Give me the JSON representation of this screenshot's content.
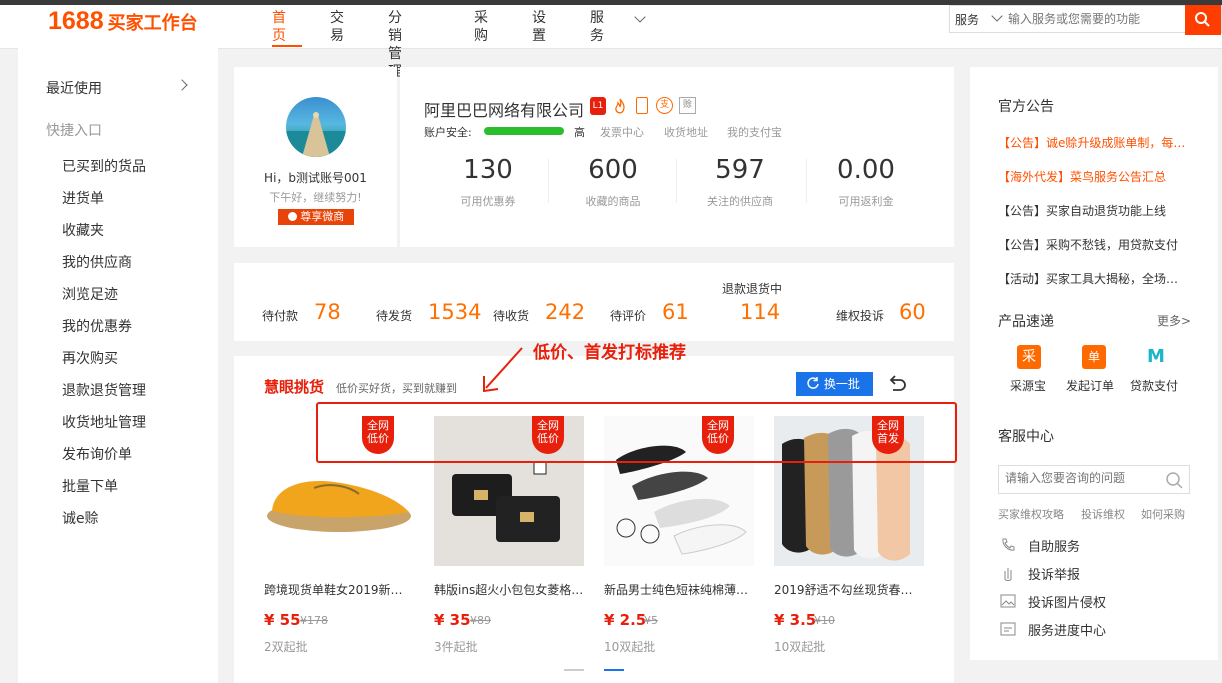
{
  "header": {
    "logo_num": "1688",
    "logo_text": "买家工作台",
    "nav": [
      "首页",
      "交易",
      "分销管理",
      "采购",
      "设置",
      "服务"
    ],
    "search_type": "服务",
    "search_placeholder": "输入服务或您需要的功能"
  },
  "sidebar": {
    "recent": "最近使用",
    "quick": "快捷入口",
    "items": [
      "已买到的货品",
      "进货单",
      "收藏夹",
      "我的供应商",
      "浏览足迹",
      "我的优惠券",
      "再次购买",
      "退款退货管理",
      "收货地址管理",
      "发布询价单",
      "批量下单",
      "诚e赊"
    ]
  },
  "profile": {
    "greeting": "Hi，b测试账号001",
    "sub": "下午好，继续努力!",
    "vip": "尊享微商",
    "company": "阿里巴巴网络有限公司",
    "level": "L1",
    "security_label": "账户安全:",
    "security_level": "高",
    "security_progress": 1.0,
    "links": [
      "发票中心",
      "收货地址",
      "我的支付宝"
    ],
    "badge_pay": "支",
    "badge_credit": "赊",
    "stats": [
      {
        "value": "130",
        "label": "可用优惠券"
      },
      {
        "value": "600",
        "label": "收藏的商品"
      },
      {
        "value": "597",
        "label": "关注的供应商"
      },
      {
        "value": "0.00",
        "label": "可用返利金"
      }
    ]
  },
  "orders": [
    {
      "label": "待付款",
      "value": "78"
    },
    {
      "label": "待发货",
      "value": "1534"
    },
    {
      "label": "待收货",
      "value": "242"
    },
    {
      "label": "待评价",
      "value": "61"
    },
    {
      "label": "退款退货中",
      "value": "114"
    },
    {
      "label": "维权投诉",
      "value": "60"
    }
  ],
  "picks": {
    "title": "慧眼挑货",
    "subtitle": "低价买好货，买到就赚到",
    "refresh": "换一批",
    "annotation": "低价、首发打标推荐",
    "products": [
      {
        "tag": "全网低价",
        "title": "跨境现货单鞋女2019新…",
        "price": "¥ 55",
        "old": "¥178",
        "moq": "2双起批"
      },
      {
        "tag": "全网低价",
        "title": "韩版ins超火小包包女菱格…",
        "price": "¥ 35",
        "old": "¥89",
        "moq": "3件起批"
      },
      {
        "tag": "全网低价",
        "title": "新品男士纯色短袜纯棉薄…",
        "price": "¥ 2.5",
        "old": "¥5",
        "moq": "10双起批"
      },
      {
        "tag": "全网首发",
        "title": "2019舒适不勾丝现货春…",
        "price": "¥ 3.5",
        "old": "¥10",
        "moq": "10双起批"
      }
    ]
  },
  "right": {
    "notice_title": "官方公告",
    "notices": [
      {
        "text": "【公告】诚e赊升级成账单制，每…",
        "highlight": true
      },
      {
        "text": "【海外代发】菜鸟服务公告汇总",
        "highlight": true
      },
      {
        "text": "【公告】买家自动退货功能上线",
        "highlight": false
      },
      {
        "text": "【公告】采购不愁钱，用贷款支付",
        "highlight": false
      },
      {
        "text": "【活动】买家工具大揭秘，全场…",
        "highlight": false
      }
    ],
    "products_title": "产品速递",
    "more": "更多>",
    "products": [
      {
        "icon": "采",
        "label": "采源宝",
        "color": "#ff6a00"
      },
      {
        "icon": "单",
        "label": "发起订单",
        "color": "#ff6a00"
      },
      {
        "icon": "M",
        "label": "贷款支付",
        "color": "#19b6c9"
      }
    ],
    "service_title": "客服中心",
    "service_placeholder": "请输入您要咨询的问题",
    "service_links": [
      "买家维权攻略",
      "投诉维权",
      "如何采购"
    ],
    "service_items": [
      "自助服务",
      "投诉举报",
      "投诉图片侵权",
      "服务进度中心"
    ]
  },
  "colors": {
    "accent": "#ff5000",
    "price": "#e8200b",
    "blue": "#1a73e8"
  }
}
